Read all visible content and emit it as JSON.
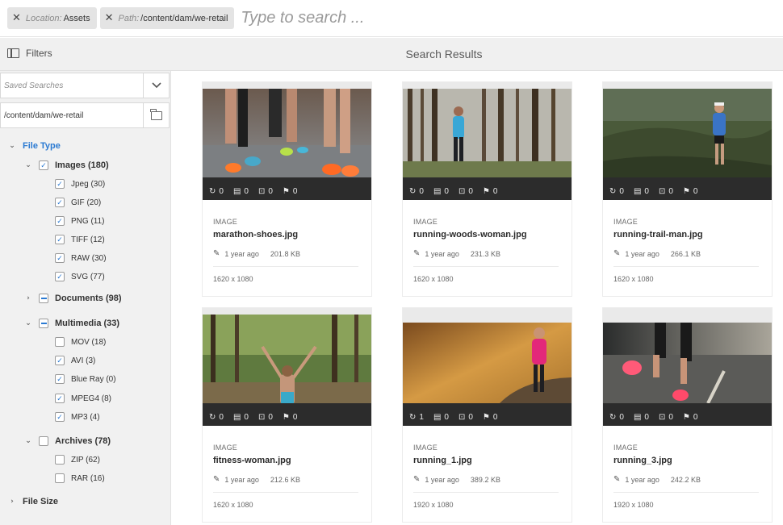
{
  "search": {
    "tags": [
      {
        "key": "Location:",
        "value": "Assets"
      },
      {
        "key": "Path:",
        "value": "/content/dam/we-retail"
      }
    ],
    "placeholder": "Type to search ..."
  },
  "toolbar": {
    "filters_label": "Filters",
    "title": "Search Results"
  },
  "rail": {
    "saved_searches_placeholder": "Saved Searches",
    "path_value": "/content/dam/we-retail",
    "file_type_label": "File Type",
    "images": {
      "label": "Images (180)",
      "items": [
        "Jpeg (30)",
        "GIF (20)",
        "PNG (11)",
        "TIFF (12)",
        "RAW (30)",
        "SVG (77)"
      ]
    },
    "documents": {
      "label": "Documents (98)"
    },
    "multimedia": {
      "label": "Multimedia (33)",
      "items": [
        "MOV (18)",
        "AVI (3)",
        "Blue Ray (0)",
        "MPEG4 (8)",
        "MP3 (4)"
      ]
    },
    "archives": {
      "label": "Archives (78)",
      "items": [
        "ZIP (62)",
        "RAR (16)"
      ]
    },
    "file_size_label": "File Size"
  },
  "cards": [
    {
      "type": "IMAGE",
      "name": "marathon-shoes.jpg",
      "modified": "1 year ago",
      "size": "201.8 KB",
      "dimensions": "1620 x 1080",
      "stats": [
        "0",
        "0",
        "0",
        "0"
      ]
    },
    {
      "type": "IMAGE",
      "name": "running-woods-woman.jpg",
      "modified": "1 year ago",
      "size": "231.3 KB",
      "dimensions": "1620 x 1080",
      "stats": [
        "0",
        "0",
        "0",
        "0"
      ]
    },
    {
      "type": "IMAGE",
      "name": "running-trail-man.jpg",
      "modified": "1 year ago",
      "size": "266.1 KB",
      "dimensions": "1620 x 1080",
      "stats": [
        "0",
        "0",
        "0",
        "0"
      ]
    },
    {
      "type": "IMAGE",
      "name": "fitness-woman.jpg",
      "modified": "1 year ago",
      "size": "212.6 KB",
      "dimensions": "1620 x 1080",
      "stats": [
        "0",
        "0",
        "0",
        "0"
      ]
    },
    {
      "type": "IMAGE",
      "name": "running_1.jpg",
      "modified": "1 year ago",
      "size": "389.2 KB",
      "dimensions": "1920 x 1080",
      "stats": [
        "1",
        "0",
        "0",
        "0"
      ]
    },
    {
      "type": "IMAGE",
      "name": "running_3.jpg",
      "modified": "1 year ago",
      "size": "242.2 KB",
      "dimensions": "1920 x 1080",
      "stats": [
        "0",
        "0",
        "0",
        "0"
      ]
    }
  ]
}
